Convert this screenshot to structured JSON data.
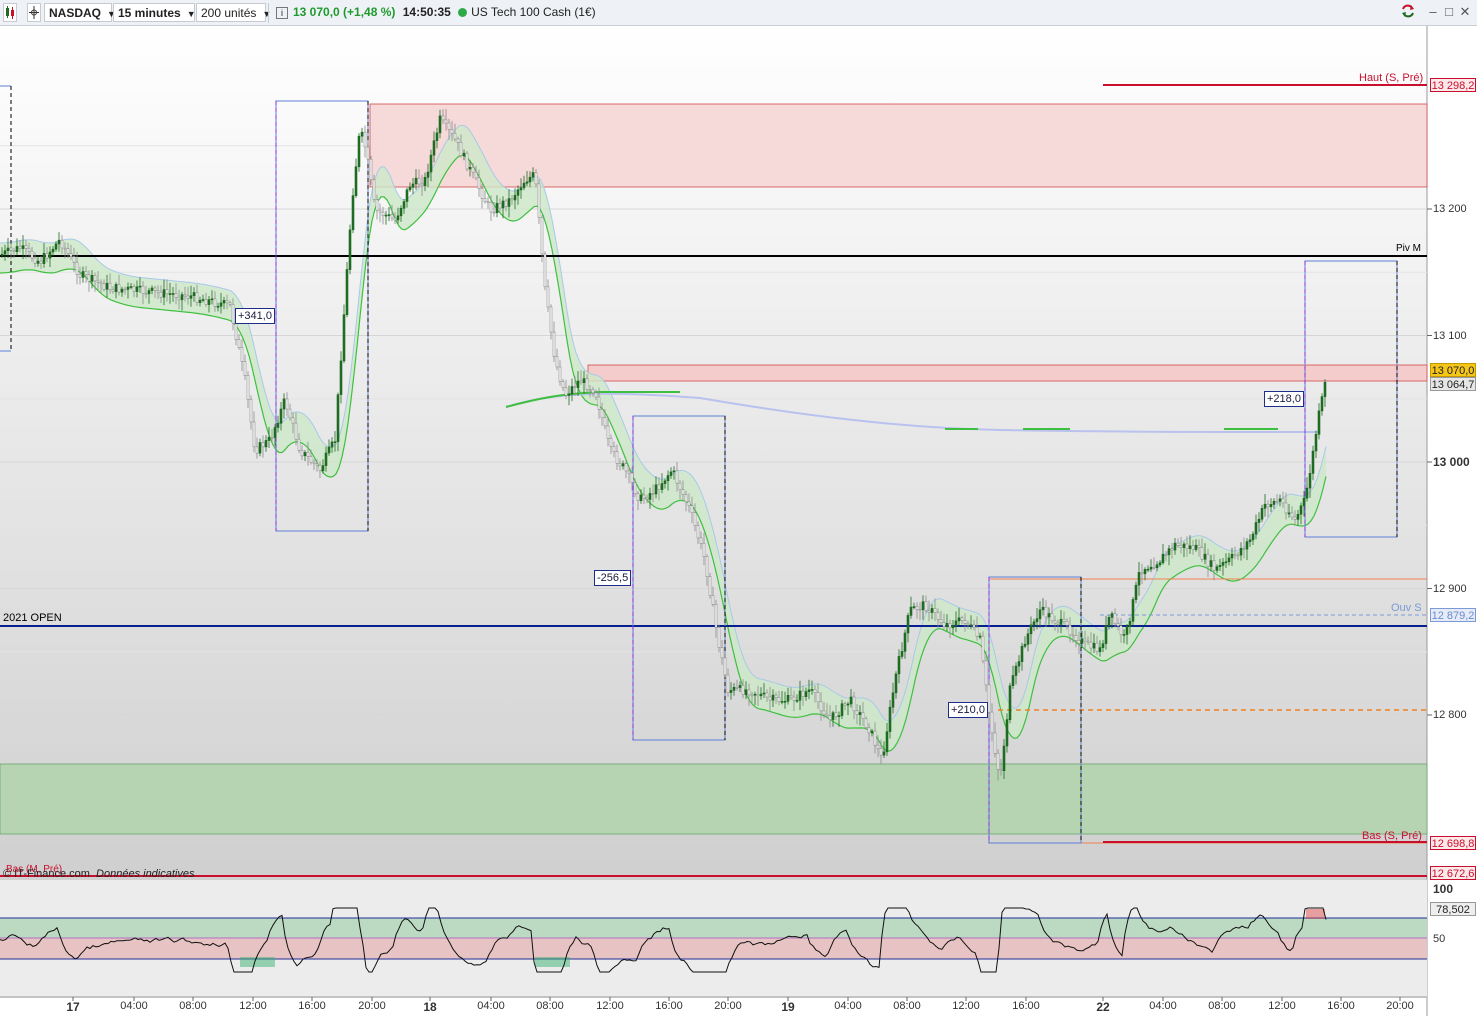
{
  "toolbar": {
    "market": "NASDAQ",
    "interval": "15 minutes",
    "units": "200 unités",
    "price_change": "13 070,0 (+1,48 %)",
    "time": "14:50:35",
    "instrument": "US Tech 100 Cash (1€)",
    "info_glyph": "i",
    "icons": [
      "chart-style-icon",
      "crosshair-icon",
      "info-icon",
      "refresh-icon",
      "minimize-icon",
      "maximize-icon",
      "close-icon"
    ],
    "window_buttons": [
      "–",
      "□",
      "✕"
    ]
  },
  "chart": {
    "y_ticks": [
      {
        "value": 13200,
        "label": "13 200"
      },
      {
        "value": 13100,
        "label": "13 100"
      },
      {
        "value": 13000,
        "label": "13 000"
      },
      {
        "value": 12900,
        "label": "12 900"
      },
      {
        "value": 12800,
        "label": "12 800"
      }
    ],
    "level_tags": [
      {
        "label": "13 298,2",
        "color": "#c8102e",
        "bg": "#fde8ea"
      },
      {
        "label": "13 070,0",
        "color": "#222",
        "bg": "#f5c518"
      },
      {
        "label": "13 064,7",
        "color": "#222",
        "bg": "#e6e6e6"
      },
      {
        "label": "12 879,2",
        "color": "#6a8ccc",
        "bg": "#e6ecf7"
      },
      {
        "label": "12 698,8",
        "color": "#c8102e",
        "bg": "#fde8ea"
      },
      {
        "label": "12 672,6",
        "color": "#c8102e",
        "bg": "#fde8ea"
      }
    ],
    "level_names": {
      "haut": "Haut (S, Pré)",
      "piv": "Piv M",
      "open2021": "2021 OPEN",
      "ouv": "Ouv S",
      "bas": "Bas (S, Pré)",
      "bas_m": "Bas (M, Pré)"
    },
    "move_labels": [
      "+341,0",
      "-256,5",
      "+210,0",
      "+218,0"
    ],
    "watermark": "© IT-Finance.com",
    "watermark_note": "Données indicatives",
    "time_labels": [
      "17",
      "04:00",
      "08:00",
      "12:00",
      "16:00",
      "20:00",
      "18",
      "04:00",
      "08:00",
      "12:00",
      "16:00",
      "20:00",
      "19",
      "04:00",
      "08:00",
      "12:00",
      "16:00",
      "22",
      "04:00",
      "08:00",
      "12:00",
      "16:00",
      "20:00"
    ],
    "colors": {
      "bull": "#1f6b22",
      "bear": "#8c8c8c",
      "pivot_line": "#000000",
      "open_line": "#0a1f8f",
      "resistance_zone": "#f6d9d9",
      "support_zone": "#b9d7b6",
      "envelope": "#cde9c8",
      "envelope_edge": "#3fbf3f",
      "ma200": "#b9c2ee"
    }
  },
  "rsi": {
    "value_label": "78,502",
    "upper_label": "100",
    "mid_label": "50"
  }
}
